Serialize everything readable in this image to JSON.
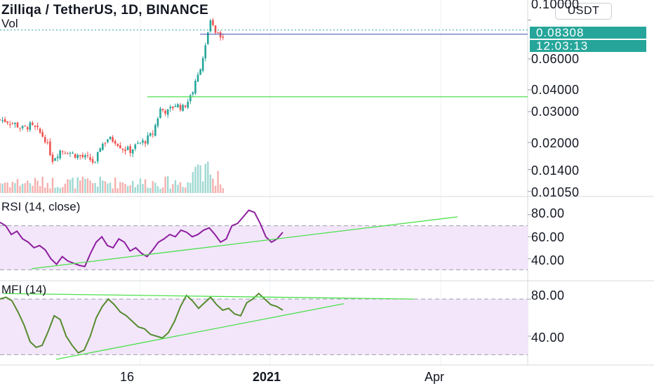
{
  "chart_title": "Zilliqa / TetherUS, 1D, BINANCE",
  "volume_label": "Vol",
  "currency_button": "USDT",
  "last_price": "0.08308",
  "countdown": "12:03:13",
  "colors": {
    "up": "#26a69a",
    "down": "#ef5350",
    "rsi_line": "#8e1f9e",
    "mfi_line": "#558b2f",
    "trendline": "#4ce04c",
    "band_fill": "#f3e6fb",
    "price_box": "#26a69a"
  },
  "chart_data": [
    {
      "type": "candlestick",
      "title": "Zilliqa / TetherUS, 1D, BINANCE",
      "y_scale": "log",
      "y_ticks": [
        "0.10000",
        "0.06000",
        "0.04000",
        "0.03000",
        "0.02000",
        "0.01400",
        "0.01050"
      ],
      "x_ticks": [
        "16",
        "2021",
        "Apr"
      ],
      "close_path": [
        {
          "date": "2020-11-05",
          "close": 0.027
        },
        {
          "date": "2020-11-08",
          "close": 0.0265
        },
        {
          "date": "2020-11-11",
          "close": 0.0255
        },
        {
          "date": "2020-11-14",
          "close": 0.024
        },
        {
          "date": "2020-11-17",
          "close": 0.025
        },
        {
          "date": "2020-11-20",
          "close": 0.0235
        },
        {
          "date": "2020-11-23",
          "close": 0.021
        },
        {
          "date": "2020-11-26",
          "close": 0.016
        },
        {
          "date": "2020-11-29",
          "close": 0.018
        },
        {
          "date": "2020-12-02",
          "close": 0.0178
        },
        {
          "date": "2020-12-05",
          "close": 0.017
        },
        {
          "date": "2020-12-08",
          "close": 0.0165
        },
        {
          "date": "2020-12-11",
          "close": 0.016
        },
        {
          "date": "2020-12-13",
          "close": 0.015
        },
        {
          "date": "2020-12-15",
          "close": 0.019
        },
        {
          "date": "2020-12-18",
          "close": 0.021
        },
        {
          "date": "2020-12-21",
          "close": 0.0205
        },
        {
          "date": "2020-12-24",
          "close": 0.0185
        },
        {
          "date": "2020-12-27",
          "close": 0.018
        },
        {
          "date": "2020-12-30",
          "close": 0.0195
        },
        {
          "date": "2021-01-02",
          "close": 0.0205
        },
        {
          "date": "2021-01-05",
          "close": 0.0225
        },
        {
          "date": "2021-01-08",
          "close": 0.031
        },
        {
          "date": "2021-01-11",
          "close": 0.03
        },
        {
          "date": "2021-01-14",
          "close": 0.033
        },
        {
          "date": "2021-01-17",
          "close": 0.0315
        },
        {
          "date": "2021-01-20",
          "close": 0.036
        },
        {
          "date": "2021-01-23",
          "close": 0.048
        },
        {
          "date": "2021-01-26",
          "close": 0.07
        },
        {
          "date": "2021-01-28",
          "close": 0.098
        },
        {
          "date": "2021-01-30",
          "close": 0.085
        },
        {
          "date": "2021-02-01",
          "close": 0.078
        },
        {
          "date": "2021-02-02",
          "close": 0.083
        }
      ],
      "annotations": {
        "resistance_line": 0.0365,
        "last_price_line": 0.08308
      }
    },
    {
      "type": "line",
      "title": "RSI (14, close)",
      "y_ticks": [
        "80.00",
        "60.00",
        "40.00"
      ],
      "band": [
        30,
        70
      ],
      "series": [
        {
          "values": [
            73,
            70,
            62,
            65,
            58,
            55,
            50,
            52,
            48,
            40,
            35,
            42,
            38,
            36,
            34,
            33,
            45,
            55,
            60,
            52,
            50,
            58,
            55,
            47,
            50,
            45,
            42,
            48,
            55,
            58,
            62,
            60,
            66,
            64,
            60,
            62,
            66,
            68,
            62,
            55,
            58,
            70,
            72,
            78,
            84,
            82,
            72,
            60,
            55,
            58,
            64
          ]
        }
      ]
    },
    {
      "type": "line",
      "title": "MFI (14)",
      "y_ticks": [
        "80.00",
        "40.00"
      ],
      "band": [
        20,
        80
      ],
      "series": [
        {
          "values": [
            80,
            82,
            78,
            66,
            52,
            34,
            28,
            30,
            45,
            62,
            58,
            40,
            30,
            22,
            25,
            40,
            60,
            72,
            80,
            74,
            66,
            62,
            56,
            50,
            48,
            42,
            40,
            38,
            44,
            56,
            72,
            84,
            78,
            70,
            76,
            82,
            74,
            68,
            70,
            64,
            62,
            76,
            80,
            86,
            80,
            74,
            72,
            68
          ]
        }
      ]
    }
  ]
}
